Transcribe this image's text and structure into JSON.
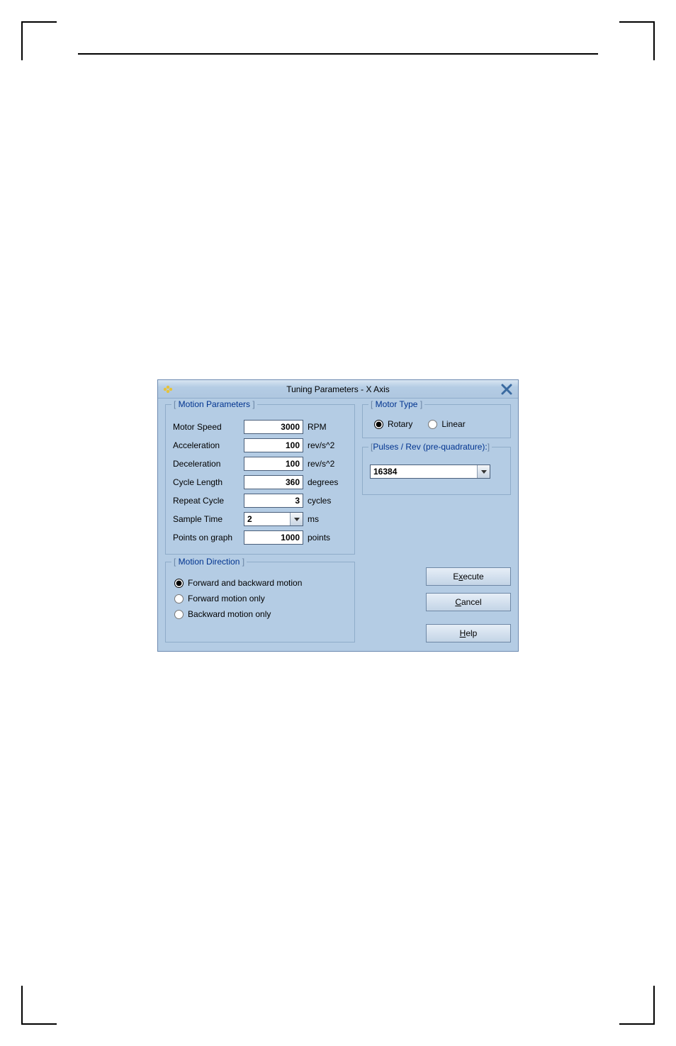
{
  "dialog": {
    "title": "Tuning Parameters - X Axis"
  },
  "motionParams": {
    "legend": "Motion Parameters",
    "rows": {
      "motorSpeed": {
        "label": "Motor Speed",
        "value": "3000",
        "unit": "RPM"
      },
      "acceleration": {
        "label": "Acceleration",
        "value": "100",
        "unit": "rev/s^2"
      },
      "deceleration": {
        "label": "Deceleration",
        "value": "100",
        "unit": "rev/s^2"
      },
      "cycleLength": {
        "label": "Cycle Length",
        "value": "360",
        "unit": "degrees"
      },
      "repeatCycle": {
        "label": "Repeat Cycle",
        "value": "3",
        "unit": "cycles"
      },
      "sampleTime": {
        "label": "Sample Time",
        "value": "2",
        "unit": "ms"
      },
      "pointsOnGraph": {
        "label": "Points on graph",
        "value": "1000",
        "unit": "points"
      }
    }
  },
  "motionDirection": {
    "legend": "Motion Direction",
    "options": {
      "fwdBack": "Forward and backward motion",
      "fwdOnly": "Forward motion only",
      "backOnly": "Backward motion only"
    },
    "selected": "fwdBack"
  },
  "motorType": {
    "legend": "Motor Type",
    "options": {
      "rotary": "Rotary",
      "linear": "Linear"
    },
    "selected": "rotary"
  },
  "pulses": {
    "legend": "Pulses / Rev (pre-quadrature):",
    "value": "16384"
  },
  "buttons": {
    "execute_pre": "E",
    "execute_ul": "x",
    "execute_post": "ecute",
    "cancel_pre": "C",
    "cancel_ul": "a",
    "cancel_post": "ncel",
    "help_pre": "H",
    "help_ul": "e",
    "help_post": "lp"
  }
}
